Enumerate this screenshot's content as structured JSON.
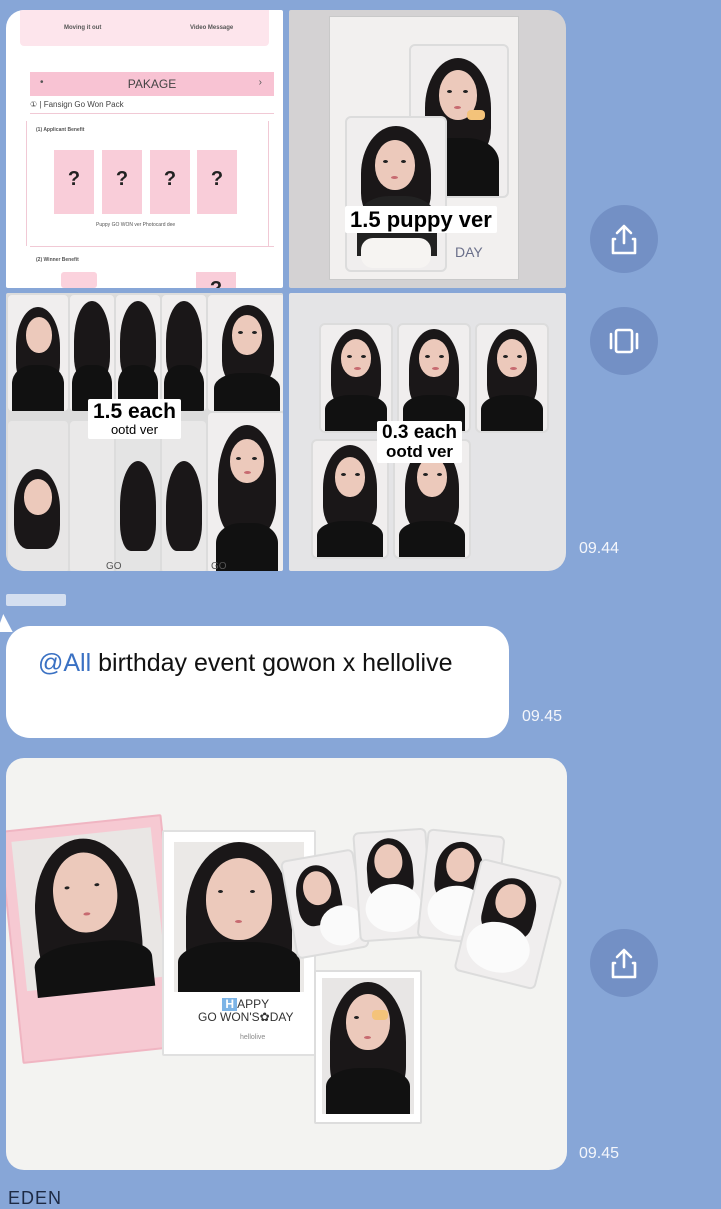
{
  "fansign_doc": {
    "top_left_text": "Moving it out",
    "top_right_text": "Video Message",
    "package_title": "PAKAGE",
    "pack_name": "① | Fansign Go Won Pack",
    "applicant_benefit": "(1) Applicant Benefit",
    "question_marks": [
      "?",
      "?",
      "?",
      "?"
    ],
    "photocard_caption": "Puppy GO WON ver Photocard dee",
    "winner_benefit": "(2) Winner Benefit",
    "winner_question": "?"
  },
  "labels": {
    "puppy": "1.5 puppy ver",
    "puppy_day": "DAY",
    "each_main": "1.5 each",
    "each_sub": "ootd ver",
    "cheap_main": "0.3 each",
    "cheap_sub": "ootd ver",
    "go_text_1": "GO",
    "go_text_2": "GO"
  },
  "message_group_1": {
    "time": "09.44"
  },
  "sender": {
    "name": ""
  },
  "message_text": {
    "mention": "@All",
    "text": " birthday event gowon x hellolive",
    "time": "09.45"
  },
  "birthday_photo": {
    "happy_line1": "APPY",
    "happy_h": "H",
    "happy_line2": "GO WON'S",
    "happy_line3": "DAY",
    "brand": "hellolive",
    "time": "09.45"
  },
  "next_sender": "EDEN",
  "icons": [
    "share-icon",
    "gallery-icon",
    "share-icon"
  ],
  "colors": {
    "chat_background": "#87a6d7",
    "bubble": "#ffffff",
    "mention": "#3a71c3",
    "share_button": "#7390c5"
  }
}
